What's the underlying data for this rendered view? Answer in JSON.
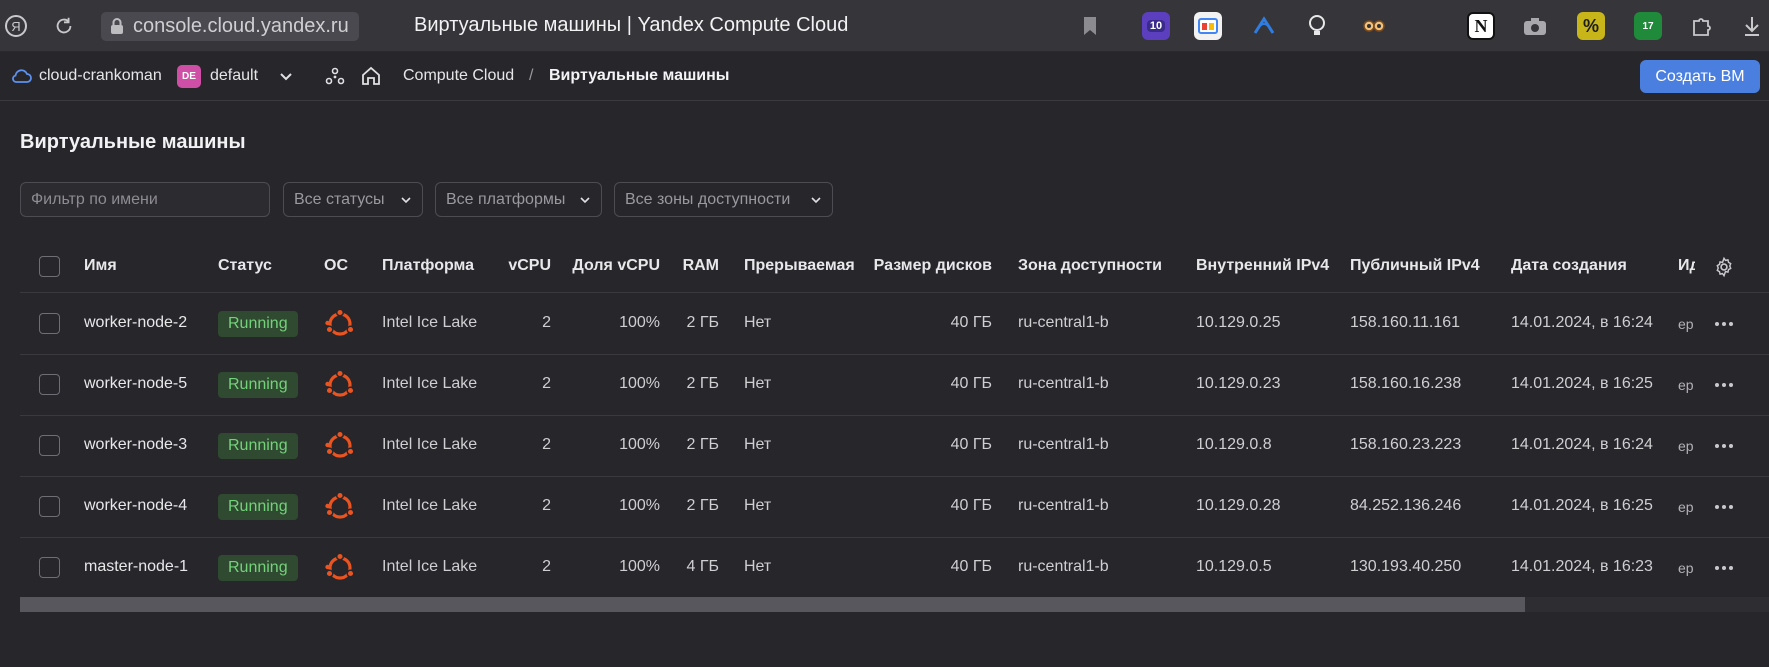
{
  "browser": {
    "url": "console.cloud.yandex.ru",
    "title": "Виртуальные машины | Yandex Compute Cloud",
    "extensions_badges": {
      "first": "10",
      "second": "17"
    }
  },
  "header": {
    "cloud": "cloud-crankoman",
    "folder_badge": "DE",
    "folder": "default",
    "breadcrumb": {
      "service": "Compute Cloud",
      "separator": "/",
      "current": "Виртуальные машины"
    },
    "create_button": "Создать ВМ"
  },
  "page": {
    "title": "Виртуальные машины",
    "filter_placeholder": "Фильтр по имени",
    "status_filter": "Все статусы",
    "platform_filter": "Все платформы",
    "zone_filter": "Все зоны доступности"
  },
  "table": {
    "columns": {
      "name": "Имя",
      "status": "Статус",
      "os": "ОС",
      "platform": "Платформа",
      "vcpu": "vCPU",
      "vcpu_share": "Доля vCPU",
      "ram": "RAM",
      "preemptible": "Прерываемая",
      "disk_size": "Размер дисков",
      "zone": "Зона доступности",
      "internal_ip": "Внутренний IPv4",
      "public_ip": "Публичный IPv4",
      "created": "Дата создания",
      "id": "Ид"
    },
    "rows": [
      {
        "name": "worker-node-2",
        "status": "Running",
        "os_icon": "ubuntu-icon",
        "platform": "Intel Ice Lake",
        "vcpu": "2",
        "vcpu_share": "100%",
        "ram": "2 ГБ",
        "preemptible": "Нет",
        "disk": "40 ГБ",
        "zone": "ru-central1-b",
        "internal_ip": "10.129.0.25",
        "public_ip": "158.160.11.161",
        "created": "14.01.2024, в 16:24",
        "id": "ep"
      },
      {
        "name": "worker-node-5",
        "status": "Running",
        "os_icon": "ubuntu-icon",
        "platform": "Intel Ice Lake",
        "vcpu": "2",
        "vcpu_share": "100%",
        "ram": "2 ГБ",
        "preemptible": "Нет",
        "disk": "40 ГБ",
        "zone": "ru-central1-b",
        "internal_ip": "10.129.0.23",
        "public_ip": "158.160.16.238",
        "created": "14.01.2024, в 16:25",
        "id": "ep"
      },
      {
        "name": "worker-node-3",
        "status": "Running",
        "os_icon": "ubuntu-icon",
        "platform": "Intel Ice Lake",
        "vcpu": "2",
        "vcpu_share": "100%",
        "ram": "2 ГБ",
        "preemptible": "Нет",
        "disk": "40 ГБ",
        "zone": "ru-central1-b",
        "internal_ip": "10.129.0.8",
        "public_ip": "158.160.23.223",
        "created": "14.01.2024, в 16:24",
        "id": "ep"
      },
      {
        "name": "worker-node-4",
        "status": "Running",
        "os_icon": "ubuntu-icon",
        "platform": "Intel Ice Lake",
        "vcpu": "2",
        "vcpu_share": "100%",
        "ram": "2 ГБ",
        "preemptible": "Нет",
        "disk": "40 ГБ",
        "zone": "ru-central1-b",
        "internal_ip": "10.129.0.28",
        "public_ip": "84.252.136.246",
        "created": "14.01.2024, в 16:25",
        "id": "ep"
      },
      {
        "name": "master-node-1",
        "status": "Running",
        "os_icon": "ubuntu-icon",
        "platform": "Intel Ice Lake",
        "vcpu": "2",
        "vcpu_share": "100%",
        "ram": "4 ГБ",
        "preemptible": "Нет",
        "disk": "40 ГБ",
        "zone": "ru-central1-b",
        "internal_ip": "10.129.0.5",
        "public_ip": "130.193.40.250",
        "created": "14.01.2024, в 16:23",
        "id": "ep"
      }
    ]
  },
  "colors": {
    "accent": "#4a7fe0",
    "status_running": "#74d27b",
    "ubuntu": "#e95420"
  }
}
